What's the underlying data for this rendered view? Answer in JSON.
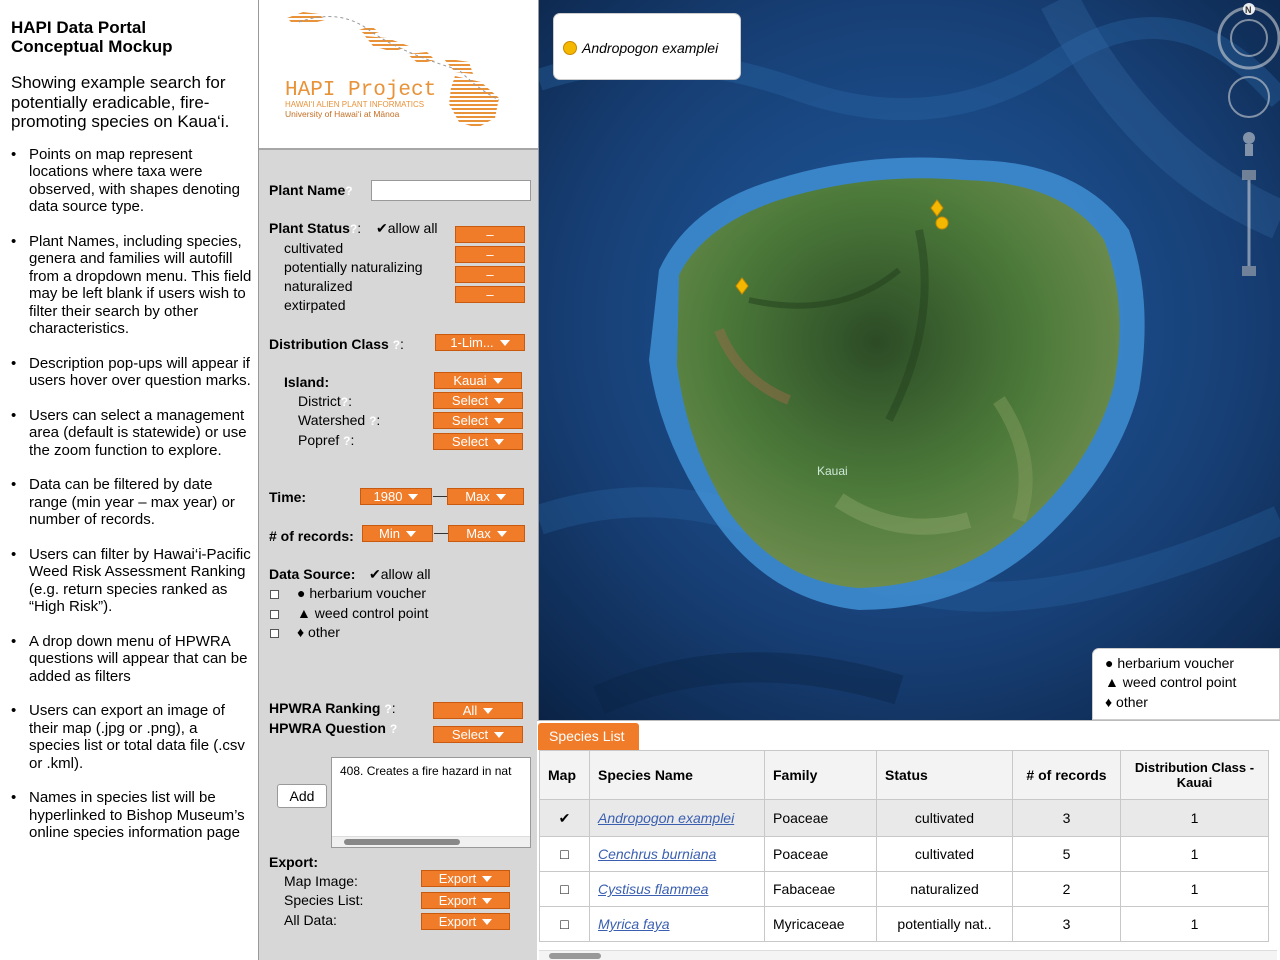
{
  "notes": {
    "title_line1": "HAPI Data Portal",
    "title_line2": "Conceptual Mockup",
    "intro": "Showing example search for potentially eradicable, fire-promoting species on Kaua‘i.",
    "bullets": [
      "Points on map represent locations where taxa were observed, with shapes denoting data source type.",
      "Plant Names, including species, genera and families will autofill from a dropdown menu. This field may be left blank if users wish to filter their search by other characteristics.",
      "Description pop-ups will appear if users hover over question marks.",
      "Users can select a management area (default is statewide) or use the zoom function to explore.",
      "Data can be filtered by date range (min year – max year) or number of records.",
      "Users can filter by Hawai‘i-Pacific Weed Risk Assessment Ranking (e.g. return species ranked as “High Risk”).",
      "A drop down menu of HPWRA questions will appear that can be added as filters",
      "Users can export an image of their map (.jpg or .png), a species list or total data file (.csv or .kml).",
      "Names in species list will be hyperlinked to Bishop Museum’s online species information page"
    ]
  },
  "logo": {
    "title": "HAPI Project",
    "line1": "HAWAI‘I ALIEN PLANT INFORMATICS",
    "line2": "University of Hawai‘i at Mānoa"
  },
  "panel": {
    "plant_name_label": "Plant Name",
    "q": "?",
    "colon": ":",
    "plant_status_label": "Plant Status",
    "allow_all": "allow all",
    "check_mark": "✔",
    "statuses": [
      "cultivated",
      "potentially naturalizing",
      "naturalized",
      "extirpated"
    ],
    "dash": "–",
    "distribution_class_label": "Distribution Class",
    "distribution_class_value": "1-Lim...",
    "island_label": "Island:",
    "island_value": "Kauai",
    "district_label": "District",
    "watershed_label": "Watershed",
    "popref_label": "Popref",
    "select": "Select",
    "time_label": "Time:",
    "time_min": "1980",
    "time_max": "Max",
    "records_label": "# of records:",
    "records_min": "Min",
    "records_max": "Max",
    "data_source_label": "Data Source:",
    "data_sources": [
      {
        "glyph": "●",
        "label": "herbarium voucher"
      },
      {
        "glyph": "▲",
        "label": "weed control point"
      },
      {
        "glyph": "♦",
        "label": "other"
      }
    ],
    "hpwra_ranking_label": "HPWRA Ranking",
    "hpwra_ranking_value": "All",
    "hpwra_question_label": "HPWRA Question",
    "hpwra_question_value": "Select",
    "add_button": "Add",
    "question_text": "408. Creates a fire hazard in nat",
    "export_label": "Export:",
    "export_rows": [
      "Map Image:",
      "Species List:",
      "All Data:"
    ],
    "export_button": "Export"
  },
  "map": {
    "legend_species": "Andropogon examplei",
    "island_name": "Kauai",
    "north": "N",
    "legend": [
      "herbarium voucher",
      "weed control point",
      "other"
    ],
    "colors": {
      "marker": "#f5b800",
      "ocean_deep": "#0c2a52",
      "land": "#3f6a33"
    }
  },
  "species": {
    "tab_label": "Species List",
    "headers": [
      "Map",
      "Species Name",
      "Family",
      "Status",
      "# of records",
      "Distribution Class - Kauai"
    ],
    "rows": [
      {
        "map": "✔",
        "name": "Andropogon examplei",
        "family": "Poaceae",
        "status": "cultivated",
        "records": "3",
        "dist": "1"
      },
      {
        "map": "□",
        "name": "Cenchrus burniana",
        "family": "Poaceae",
        "status": "cultivated",
        "records": "5",
        "dist": "1"
      },
      {
        "map": "□",
        "name": "Cystisus flammea",
        "family": "Fabaceae",
        "status": "naturalized",
        "records": "2",
        "dist": "1"
      },
      {
        "map": "□",
        "name": "Myrica faya",
        "family": "Myricaceae",
        "status": "potentially nat..",
        "records": "3",
        "dist": "1"
      }
    ]
  }
}
